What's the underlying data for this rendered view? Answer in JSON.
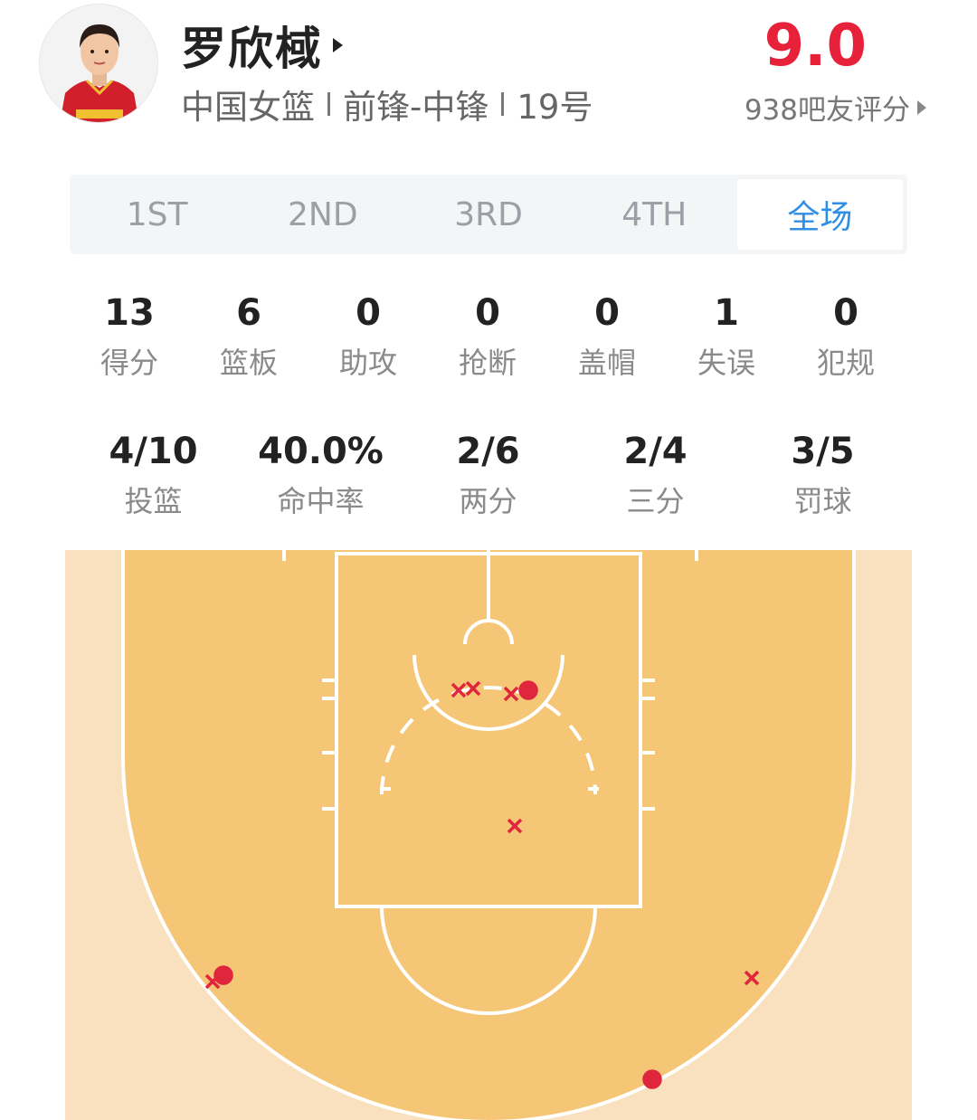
{
  "player": {
    "name": "罗欣棫",
    "team": "中国女篮",
    "position": "前锋-中锋",
    "number": "19号"
  },
  "rating": {
    "score": "9.0",
    "label": "938吧友评分"
  },
  "tabs": [
    {
      "label": "1ST",
      "active": false
    },
    {
      "label": "2ND",
      "active": false
    },
    {
      "label": "3RD",
      "active": false
    },
    {
      "label": "4TH",
      "active": false
    },
    {
      "label": "全场",
      "active": true
    }
  ],
  "stats": [
    {
      "value": "13",
      "label": "得分"
    },
    {
      "value": "6",
      "label": "篮板"
    },
    {
      "value": "0",
      "label": "助攻"
    },
    {
      "value": "0",
      "label": "抢断"
    },
    {
      "value": "0",
      "label": "盖帽"
    },
    {
      "value": "1",
      "label": "失误"
    },
    {
      "value": "0",
      "label": "犯规"
    }
  ],
  "shooting": [
    {
      "value": "4/10",
      "label": "投篮"
    },
    {
      "value": "40.0%",
      "label": "命中率"
    },
    {
      "value": "2/6",
      "label": "两分"
    },
    {
      "value": "2/4",
      "label": "三分"
    },
    {
      "value": "3/5",
      "label": "罚球"
    }
  ],
  "colors": {
    "accent_red": "#e8213b",
    "tab_active_blue": "#2f8fe6",
    "court_inner": "#f6c677",
    "court_outer": "#f9e1bf",
    "court_lines": "#ffffff",
    "shot_marker": "#e0263c"
  },
  "shot_chart": {
    "legend": {
      "made": "dot",
      "missed": "x"
    }
  }
}
